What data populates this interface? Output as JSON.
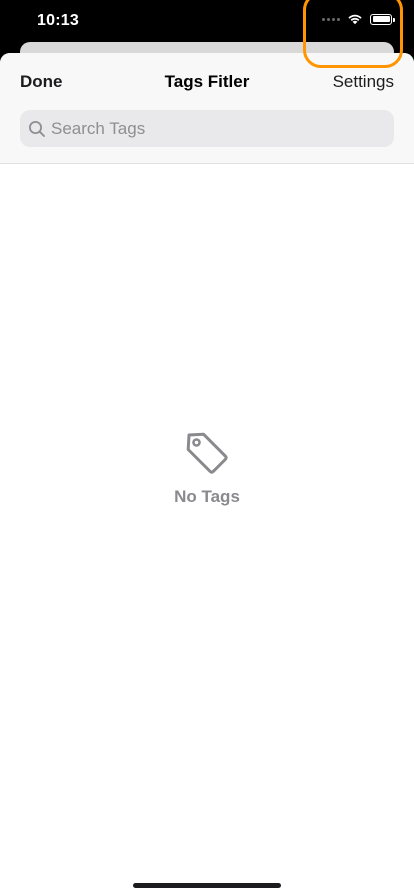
{
  "status_bar": {
    "time": "10:13",
    "icons": [
      "signal-dots-icon",
      "wifi-icon",
      "battery-icon"
    ]
  },
  "nav": {
    "done_label": "Done",
    "title": "Tags Fitler",
    "settings_label": "Settings"
  },
  "search": {
    "placeholder": "Search Tags",
    "value": ""
  },
  "empty_state": {
    "icon": "tag-icon",
    "label": "No Tags"
  },
  "colors": {
    "highlight": "#ff9500",
    "nav_background": "#f8f8f8",
    "search_background": "#e9e9eb",
    "empty_text": "#8a8a8e"
  }
}
